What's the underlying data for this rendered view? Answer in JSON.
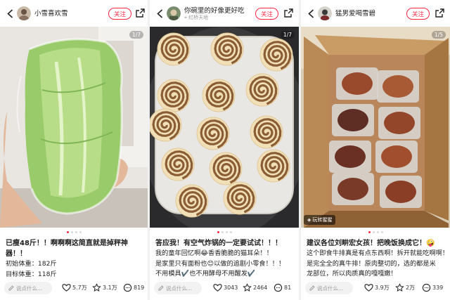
{
  "posts": [
    {
      "user": {
        "name": "小雪喜欢雪",
        "subtitle": ""
      },
      "follow_label": "关注",
      "photo": {
        "counter": "1/7",
        "subject": "lettuce-in-plastic-wrap"
      },
      "caption": {
        "title": "已瘦48斤！！啊啊啊这简直就是掉秤神器！！",
        "lines": [
          "初始体重：182斤",
          "目标体重：118斤"
        ]
      },
      "comment_placeholder": "说点什么...",
      "stats": {
        "likes": "5.7万",
        "favorites": "3.1万",
        "comments": "819"
      }
    },
    {
      "user": {
        "name": "你碗里的好像更好吃",
        "subtitle": "红桥天地"
      },
      "follow_label": "关注",
      "photo": {
        "counter": "1/7",
        "subject": "pinwheel-cookies-in-air-fryer"
      },
      "caption": {
        "title": "答应我！有空气炸锅的一定要试试！！！",
        "lines": [
          "我的童年回忆啊😂香香脆脆的猫耳朵！！",
          "是家里只有面粉也😊以做的追剧小零食！！！",
          "不用模具✔️也不用酵母不用醒发✔️"
        ]
      },
      "comment_placeholder": "说点什么...",
      "stats": {
        "likes": "3043",
        "favorites": "2464",
        "comments": "81"
      }
    },
    {
      "user": {
        "name": "猛男爱喝雪碧",
        "subtitle": ""
      },
      "follow_label": "关注",
      "photo": {
        "counter": "1/5",
        "subject": "vacuum-packed-meat-in-box",
        "badge": "玩转猩猩"
      },
      "caption": {
        "title": "建议各位刘畊宏女孩！把晚饭换成它！🤪",
        "lines": [
          "这个即食牛排真是有点东西啊！拆开就能吃啊啊！",
          "是完全全的真牛排！原肉整切的，选的都是米",
          "龙部位，所以肉质真的嘎嘎嫩！"
        ]
      },
      "comment_placeholder": "说点什么...",
      "stats": {
        "likes": "3.9万",
        "favorites": "2万",
        "comments": "339"
      }
    }
  ],
  "colors": {
    "accent": "#ff2442",
    "muted": "#999999"
  },
  "icons": [
    "back-arrow-icon",
    "share-icon",
    "heart-icon",
    "star-icon",
    "comment-icon",
    "pencil-icon"
  ]
}
